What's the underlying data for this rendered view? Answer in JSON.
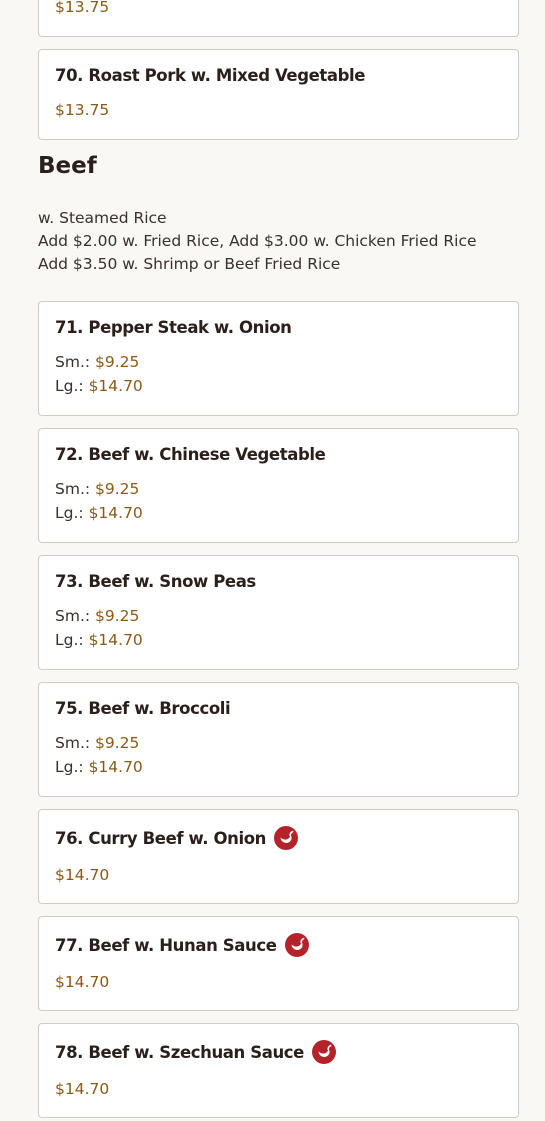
{
  "partial_top_item": {
    "price": "$13.75"
  },
  "section": {
    "title": "Beef",
    "notes": [
      "w. Steamed Rice",
      "Add $2.00 w. Fried Rice, Add $3.00 w. Chicken Fried Rice",
      "Add $3.50 w. Shrimp or Beef Fried Rice"
    ]
  },
  "items": [
    {
      "name": "70. Roast Pork w. Mixed Vegetable",
      "price": "$13.75"
    },
    {
      "name": "71. Pepper Steak w. Onion",
      "sm_label": "Sm.:",
      "sm_price": "$9.25",
      "lg_label": "Lg.:",
      "lg_price": "$14.70"
    },
    {
      "name": "72. Beef w. Chinese Vegetable",
      "sm_label": "Sm.:",
      "sm_price": "$9.25",
      "lg_label": "Lg.:",
      "lg_price": "$14.70"
    },
    {
      "name": "73. Beef w. Snow Peas",
      "sm_label": "Sm.:",
      "sm_price": "$9.25",
      "lg_label": "Lg.:",
      "lg_price": "$14.70"
    },
    {
      "name": "75. Beef w. Broccoli",
      "sm_label": "Sm.:",
      "sm_price": "$9.25",
      "lg_label": "Lg.:",
      "lg_price": "$14.70"
    },
    {
      "name": "76. Curry Beef w. Onion",
      "price": "$14.70",
      "icon": "spicy-pepper-icon"
    },
    {
      "name": "77. Beef w. Hunan Sauce",
      "price": "$14.70",
      "icon": "spicy-pepper-icon"
    },
    {
      "name": "78. Beef w. Szechuan Sauce",
      "price": "$14.70",
      "icon": "spicy-pepper-icon"
    }
  ],
  "colors": {
    "price": "#8a5a16",
    "spicy_icon": "#b3242a",
    "card_border": "#cfcac2",
    "background": "#f9f8f5"
  }
}
